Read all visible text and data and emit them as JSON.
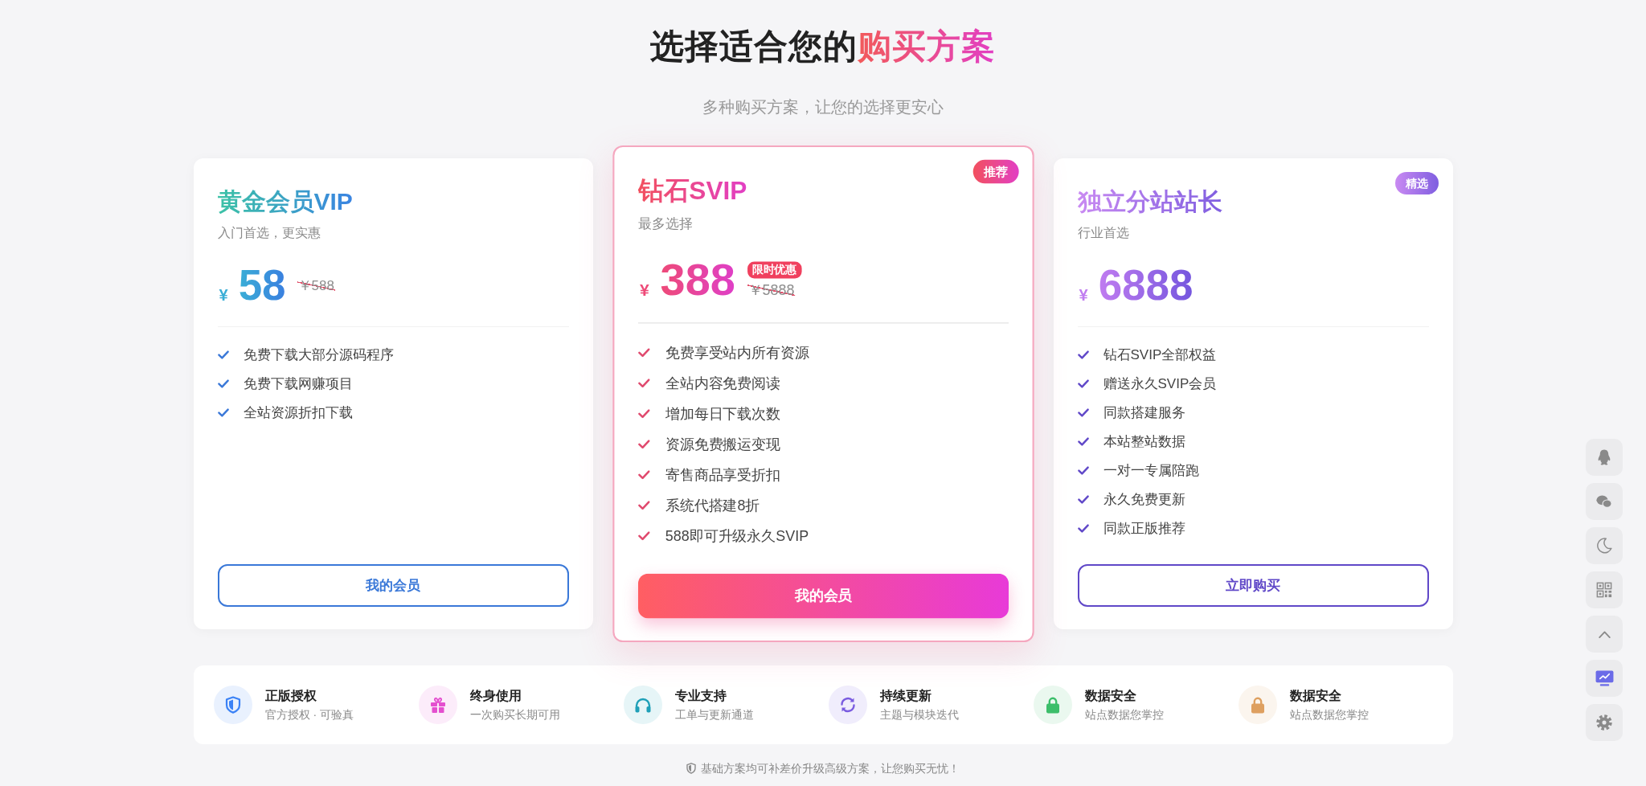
{
  "header": {
    "title": "选择适合您的",
    "title_highlight": "购买方案",
    "subtitle": "多种购买方案，让您的选择更安心"
  },
  "plans": [
    {
      "name": "黄金会员VIP",
      "tagline": "入门首选，更实惠",
      "currency": "¥",
      "price": "58",
      "original_price": "￥588",
      "features": [
        "免费下载大部分源码程序",
        "免费下载网赚项目",
        "全站资源折扣下载"
      ],
      "button": "我的会员",
      "featured": false,
      "color": "#3a78d8"
    },
    {
      "name": "钻石SVIP",
      "badge": "推荐",
      "tagline": "最多选择",
      "currency": "¥",
      "price": "388",
      "promo_tag": "限时优惠",
      "original_price": "￥5888",
      "features": [
        "免费享受站内所有资源",
        "全站内容免费阅读",
        "增加每日下载次数",
        "资源免费搬运变现",
        "寄售商品享受折扣",
        "系统代搭建8折",
        "588即可升级永久SVIP"
      ],
      "button": "我的会员",
      "featured": true,
      "color": "#e04a6e"
    },
    {
      "name": "独立分站站长",
      "badge": "精选",
      "tagline": "行业首选",
      "currency": "¥",
      "price": "6888",
      "features": [
        "钻石SVIP全部权益",
        "赠送永久SVIP会员",
        "同款搭建服务",
        "本站整站数据",
        "一对一专属陪跑",
        "永久免费更新",
        "同款正版推荐"
      ],
      "button": "立即购买",
      "featured": false,
      "color": "#6048c8"
    }
  ],
  "highlights": [
    {
      "title": "正版授权",
      "subtitle": "官方授权 · 可验真"
    },
    {
      "title": "终身使用",
      "subtitle": "一次购买长期可用"
    },
    {
      "title": "专业支持",
      "subtitle": "工单与更新通道"
    },
    {
      "title": "持续更新",
      "subtitle": "主题与模块迭代"
    },
    {
      "title": "数据安全",
      "subtitle": "站点数据您掌控"
    },
    {
      "title": "数据安全",
      "subtitle": "站点数据您掌控"
    }
  ],
  "footer_note": "基础方案均可补差价升级高级方案，让您购买无忧！"
}
